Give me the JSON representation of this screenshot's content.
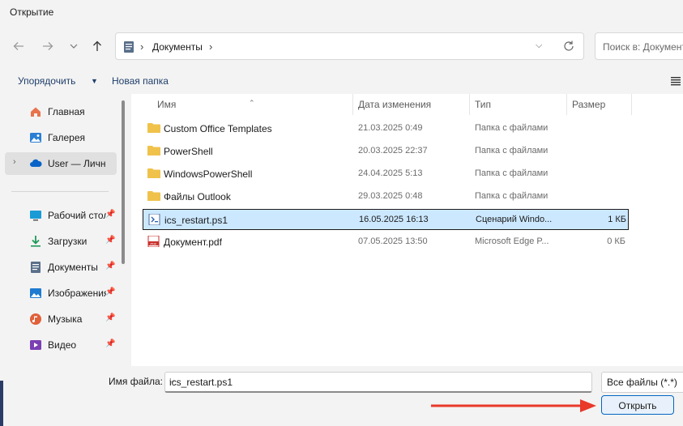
{
  "window": {
    "title": "Открытие"
  },
  "nav": {
    "back_icon": "arrow-left-icon",
    "forward_icon": "arrow-right-icon",
    "recent_icon": "chevron-down-icon",
    "up_icon": "arrow-up-icon"
  },
  "address": {
    "separator": "›",
    "breadcrumb": "Документы"
  },
  "search": {
    "placeholder": "Поиск в: Документы"
  },
  "toolbar": {
    "organize_label": "Упорядочить",
    "new_folder_label": "Новая папка"
  },
  "sidebar": {
    "items": [
      {
        "label": "Главная",
        "icon": "home-icon",
        "pinned": false
      },
      {
        "label": "Галерея",
        "icon": "gallery-icon",
        "pinned": false
      },
      {
        "label": "User — Личное",
        "icon": "onedrive-cloud-icon",
        "pinned": false,
        "selected": true
      },
      {
        "label": "Рабочий стол",
        "icon": "desktop-icon",
        "pinned": true
      },
      {
        "label": "Загрузки",
        "icon": "download-icon",
        "pinned": true
      },
      {
        "label": "Документы",
        "icon": "documents-icon",
        "pinned": true
      },
      {
        "label": "Изображения",
        "icon": "pictures-icon",
        "pinned": true
      },
      {
        "label": "Музыка",
        "icon": "music-icon",
        "pinned": true
      },
      {
        "label": "Видео",
        "icon": "video-icon",
        "pinned": true
      }
    ]
  },
  "columns": {
    "name": "Имя",
    "date": "Дата изменения",
    "type": "Тип",
    "size": "Размер"
  },
  "files": [
    {
      "name": "Custom Office Templates",
      "date": "21.03.2025 0:49",
      "type": "Папка с файлами",
      "size": "",
      "icon": "folder-icon"
    },
    {
      "name": "PowerShell",
      "date": "20.03.2025 22:37",
      "type": "Папка с файлами",
      "size": "",
      "icon": "folder-icon"
    },
    {
      "name": "WindowsPowerShell",
      "date": "24.04.2025 5:13",
      "type": "Папка с файлами",
      "size": "",
      "icon": "folder-icon"
    },
    {
      "name": "Файлы Outlook",
      "date": "29.03.2025 0:48",
      "type": "Папка с файлами",
      "size": "",
      "icon": "folder-icon"
    },
    {
      "name": "ics_restart.ps1",
      "date": "16.05.2025 16:13",
      "type": "Сценарий Windo...",
      "size": "1 КБ",
      "icon": "script-file-icon",
      "selected": true
    },
    {
      "name": "Документ.pdf",
      "date": "07.05.2025 13:50",
      "type": "Microsoft Edge P...",
      "size": "0 КБ",
      "icon": "pdf-file-icon"
    }
  ],
  "footer": {
    "filename_label": "Имя файла:",
    "filename_value": "ics_restart.ps1",
    "filter_value": "Все файлы (*.*)",
    "open_label": "Открыть"
  },
  "colors": {
    "accent": "#0067c0",
    "selection": "#cce8ff",
    "folder": "#f0c24c",
    "annotation_arrow": "#e8392b"
  }
}
